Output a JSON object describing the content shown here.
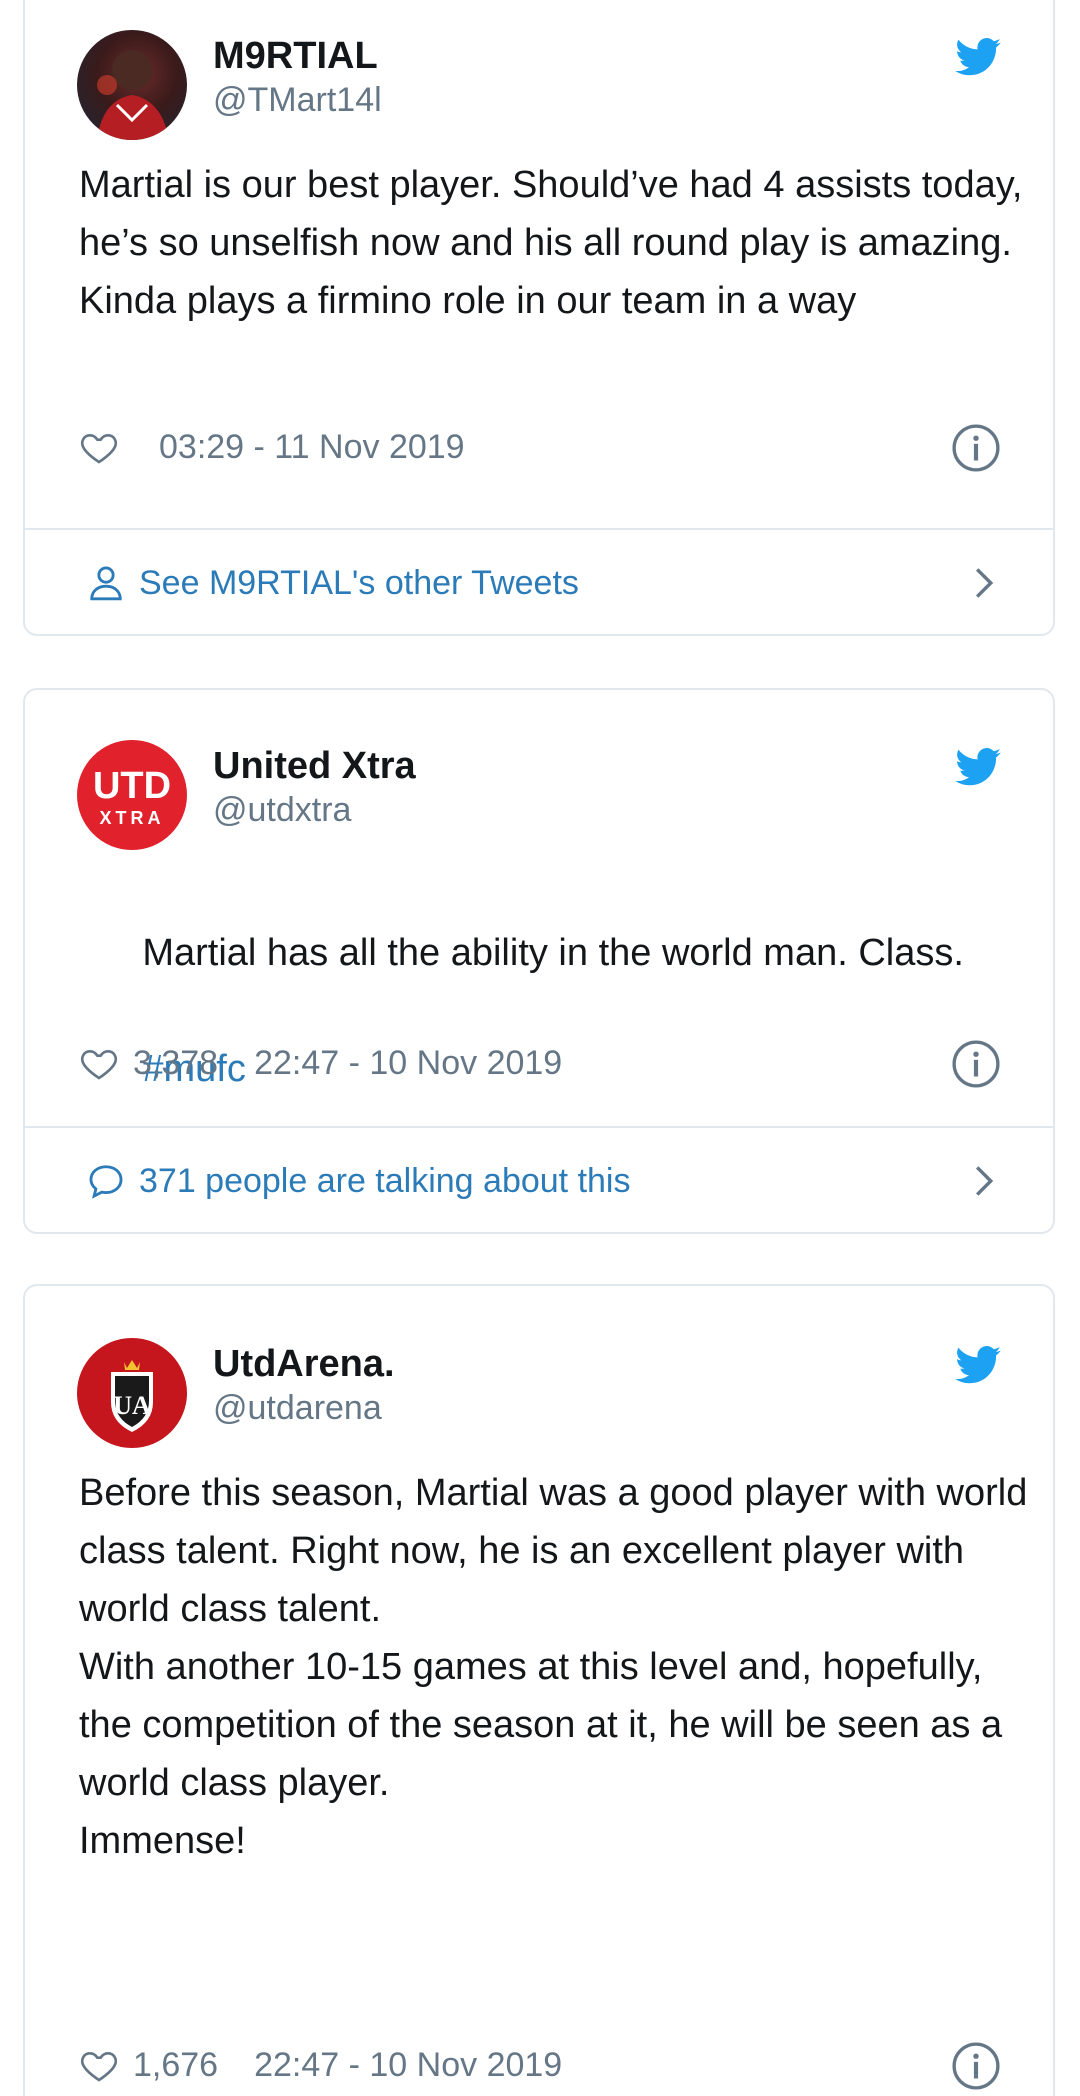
{
  "tweets": [
    {
      "name": "M9RTIAL",
      "handle": "@TMart14l",
      "text": "Martial is our best player. Should’ve had 4 assists today, he’s so unselfish now and his all round play is amazing. Kinda plays a firmino role in our team in a way",
      "likes": "",
      "timestamp": "03:29 - 11 Nov 2019",
      "footer": "See M9RTIAL's other Tweets"
    },
    {
      "name": "United Xtra",
      "handle": "@utdxtra",
      "text": "Martial has all the ability in the world man. Class.",
      "hashtag": "#mufc",
      "likes": "3,378",
      "timestamp": "22:47 - 10 Nov 2019",
      "footer": "371 people are talking about this",
      "avatar_text_top": "UTD",
      "avatar_text_bottom": "XTRA"
    },
    {
      "name": "UtdArena.",
      "handle": "@utdarena",
      "text_p1": "Before this season, Martial was a good player with world class talent. Right now, he is an excellent player with world class talent.",
      "text_p2": "With another 10-15 games at this level and, hopefully, the competition of the season at it, he will be seen as a world class player.",
      "text_p3": "Immense!",
      "likes": "1,676",
      "timestamp": "22:47 - 10 Nov 2019",
      "avatar_text": "UA"
    }
  ],
  "colors": {
    "link": "#2b7bb9",
    "twitter_blue": "#1da1f2",
    "secondary_text": "#657786",
    "border": "#e1e8ed"
  }
}
